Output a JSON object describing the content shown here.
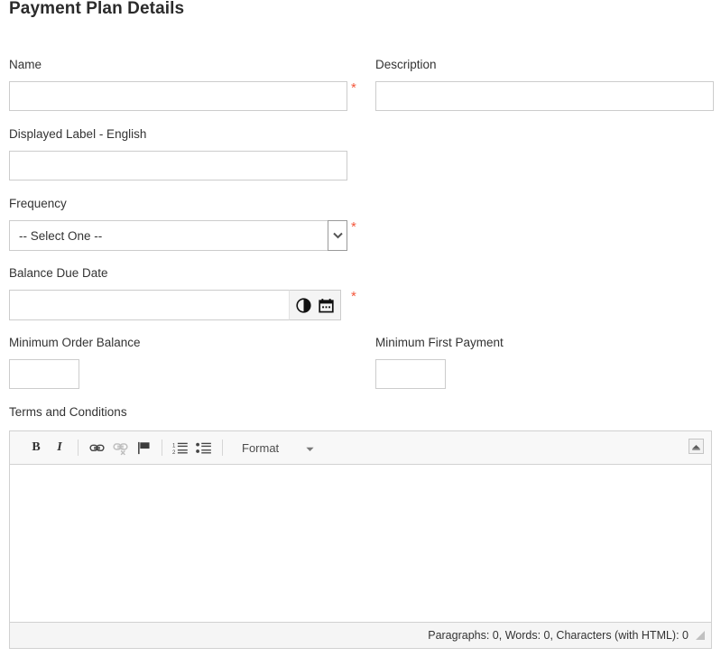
{
  "page": {
    "title": "Payment Plan Details"
  },
  "fields": {
    "name": {
      "label": "Name",
      "value": "",
      "placeholder": "",
      "required_marker": "*"
    },
    "description": {
      "label": "Description",
      "value": "",
      "placeholder": ""
    },
    "displayed_label_english": {
      "label": "Displayed Label - English",
      "value": "",
      "placeholder": ""
    },
    "frequency": {
      "label": "Frequency",
      "selected": "-- Select One --",
      "required_marker": "*"
    },
    "balance_due_date": {
      "label": "Balance Due Date",
      "value": "",
      "placeholder": "",
      "required_marker": "*",
      "time_icon": "clock-icon",
      "calendar_icon": "calendar-icon"
    },
    "minimum_order_balance": {
      "label": "Minimum Order Balance",
      "value": "",
      "placeholder": ""
    },
    "minimum_first_payment": {
      "label": "Minimum First Payment",
      "value": "",
      "placeholder": ""
    },
    "terms_and_conditions": {
      "label": "Terms and Conditions",
      "content": ""
    }
  },
  "editor": {
    "toolbar": {
      "bold_label": "B",
      "italic_label": "I",
      "link_icon": "link-icon",
      "unlink_icon": "unlink-icon",
      "anchor_icon": "flag-anchor-icon",
      "numbered_list_icon": "numbered-list-icon",
      "bulleted_list_icon": "bulleted-list-icon",
      "format_label": "Format",
      "format_arrow_icon": "chevron-down-icon",
      "collapse_icon": "collapse-toolbar-icon"
    },
    "status": "Paragraphs: 0, Words: 0, Characters (with HTML): 0",
    "resize_grip_icon": "resize-grip-icon"
  },
  "colors": {
    "required": "#f4583c",
    "text": "#333333",
    "border": "#cccccc",
    "toolbar_bg": "#f8f8f8",
    "status_bg": "#f5f5f5"
  }
}
